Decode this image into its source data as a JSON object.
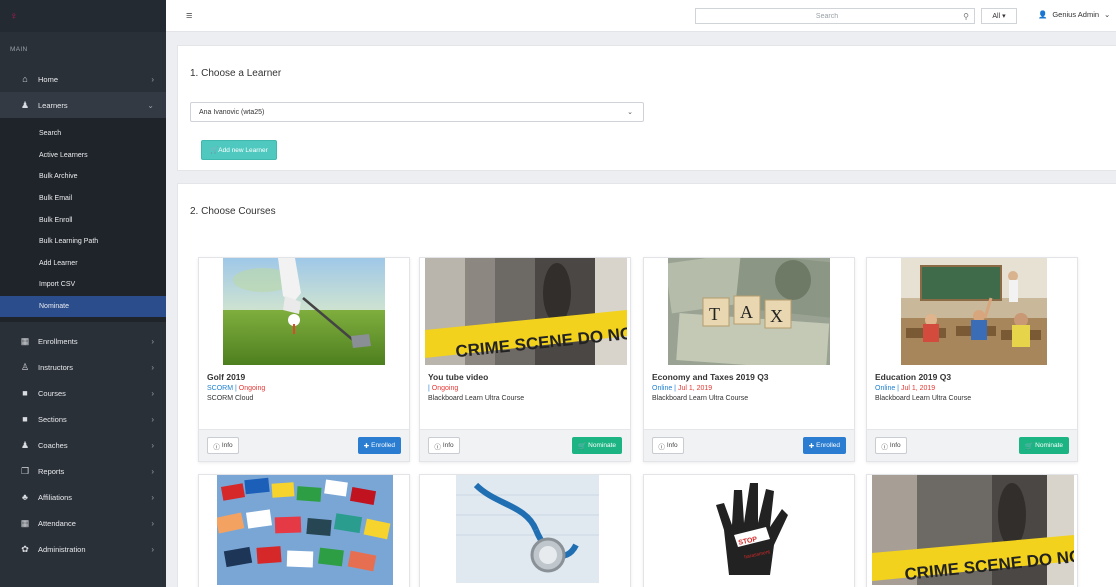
{
  "sidebar": {
    "section": "MAIN",
    "nav": [
      {
        "label": "Home",
        "icon": "home-icon"
      },
      {
        "label": "Learners",
        "icon": "learners-icon"
      }
    ],
    "sub": [
      "Search",
      "Active Learners",
      "Bulk Archive",
      "Bulk Email",
      "Bulk Enroll",
      "Bulk Learning Path",
      "Add Learner",
      "Import CSV",
      "Nominate"
    ],
    "nav2": [
      {
        "label": "Enrollments",
        "icon": "calendar-icon"
      },
      {
        "label": "Instructors",
        "icon": "instructor-icon"
      },
      {
        "label": "Courses",
        "icon": "book-icon"
      },
      {
        "label": "Sections",
        "icon": "book-icon"
      },
      {
        "label": "Coaches",
        "icon": "coach-icon"
      },
      {
        "label": "Reports",
        "icon": "copy-icon"
      },
      {
        "label": "Affiliations",
        "icon": "sitemap-icon"
      },
      {
        "label": "Attendance",
        "icon": "calendar-icon"
      },
      {
        "label": "Administration",
        "icon": "gear-icon"
      }
    ]
  },
  "topbar": {
    "search_placeholder": "Search",
    "scope": "All ▾",
    "user": "Genius Admin"
  },
  "step1": {
    "title": "1. Choose a Learner",
    "selected_learner": "Ana Ivanovic (wta25)",
    "add_button": "Add new Learner"
  },
  "step2": {
    "title": "2. Choose Courses",
    "cards": [
      {
        "title": "Golf 2019",
        "type": "SCORM",
        "sep": " | ",
        "status": "Ongoing",
        "provider": "SCORM Cloud",
        "info": "Info",
        "action": "Enrolled",
        "action_kind": "enrolled"
      },
      {
        "title": "You tube video",
        "type": "",
        "sep": "| ",
        "status": "Ongoing",
        "provider": "Blackboard Learn Ultra Course",
        "info": "Info",
        "action": "Nominate",
        "action_kind": "nominate"
      },
      {
        "title": "Economy and Taxes 2019 Q3",
        "type": "Online",
        "sep": " | ",
        "status": "Jul 1, 2019",
        "provider": "Blackboard Learn Ultra Course",
        "info": "Info",
        "action": "Enrolled",
        "action_kind": "enrolled"
      },
      {
        "title": "Education 2019 Q3",
        "type": "Online",
        "sep": " | ",
        "status": "Jul 1, 2019",
        "provider": "Blackboard Learn Ultra Course",
        "info": "Info",
        "action": "Nominate",
        "action_kind": "nominate"
      }
    ]
  },
  "thumb_text": {
    "crime": "CRIME SCENE DO NOT",
    "tax": [
      "T",
      "A",
      "X"
    ],
    "hand_words": [
      "STOP",
      "harassment"
    ]
  },
  "colors": {
    "sidebar_bg": "#2a3038",
    "active_item": "#2b4d8c",
    "enrolled": "#2a7dd1",
    "nominate": "#1cb482",
    "add_button": "#4fc9c0"
  }
}
